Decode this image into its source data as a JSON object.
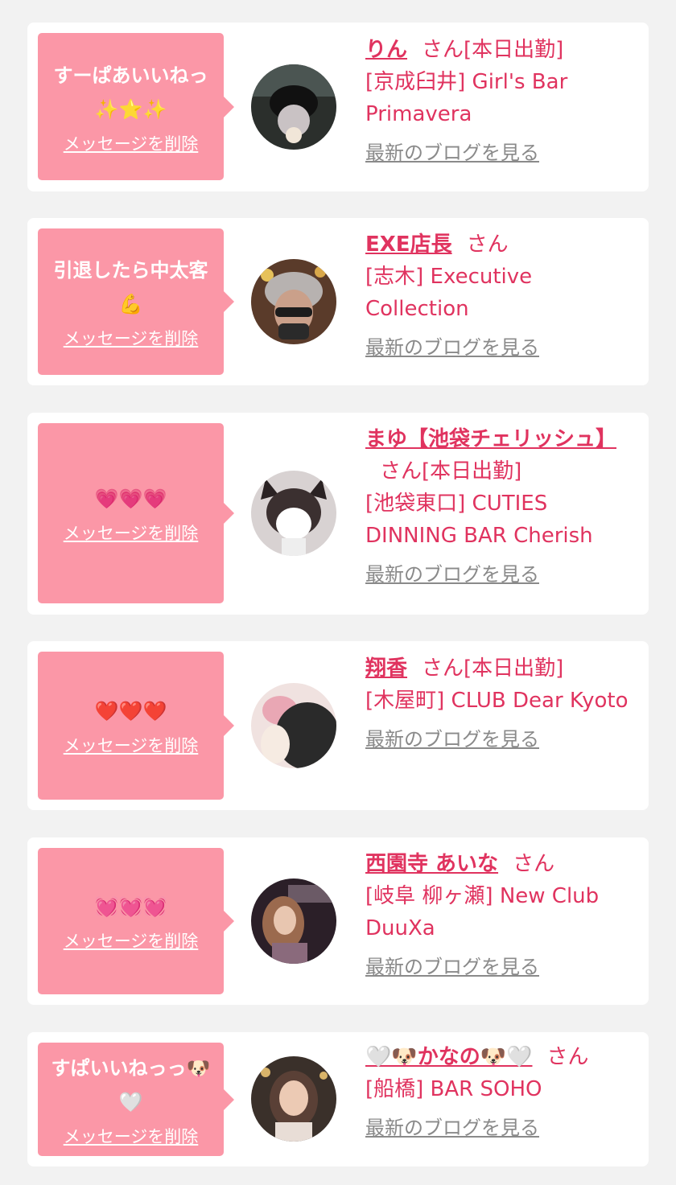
{
  "delete_label": "メッセージを削除",
  "blog_label": "最新のブログを見る",
  "entries": [
    {
      "message": "すーぱあいいねっ\n✨⭐✨",
      "name": "りん",
      "suffix": "さん[本日出勤]",
      "shop": "[京成臼井] Girl's Bar Primavera"
    },
    {
      "message": "引退したら中太客\n💪",
      "name": "EXE店長",
      "suffix": "さん",
      "shop": "[志木] Executive Collection"
    },
    {
      "message": "💗💗💗",
      "name": "まゆ【池袋チェリッシュ】",
      "suffix": "さん[本日出勤]",
      "shop": "[池袋東口] CUTIES DINNING BAR Cherish"
    },
    {
      "message": "❤️❤️❤️",
      "name": "翔香",
      "suffix": "さん[本日出勤]",
      "shop": "[木屋町] CLUB Dear Kyoto"
    },
    {
      "message": "💓💓💓",
      "name": "西園寺 あいな",
      "suffix": "さん",
      "shop": "[岐阜 柳ヶ瀬] New Club DuuXa"
    },
    {
      "message": "すぱいいねっっ🐶\n🤍",
      "name": "🤍🐶かなの🐶🤍",
      "suffix": "さん",
      "shop": "[船橋] BAR SOHO"
    }
  ],
  "colors": {
    "accent": "#e0335f",
    "bubble": "#fb97a7",
    "link_gray": "#8a8a8a",
    "background": "#f2f2f2"
  }
}
